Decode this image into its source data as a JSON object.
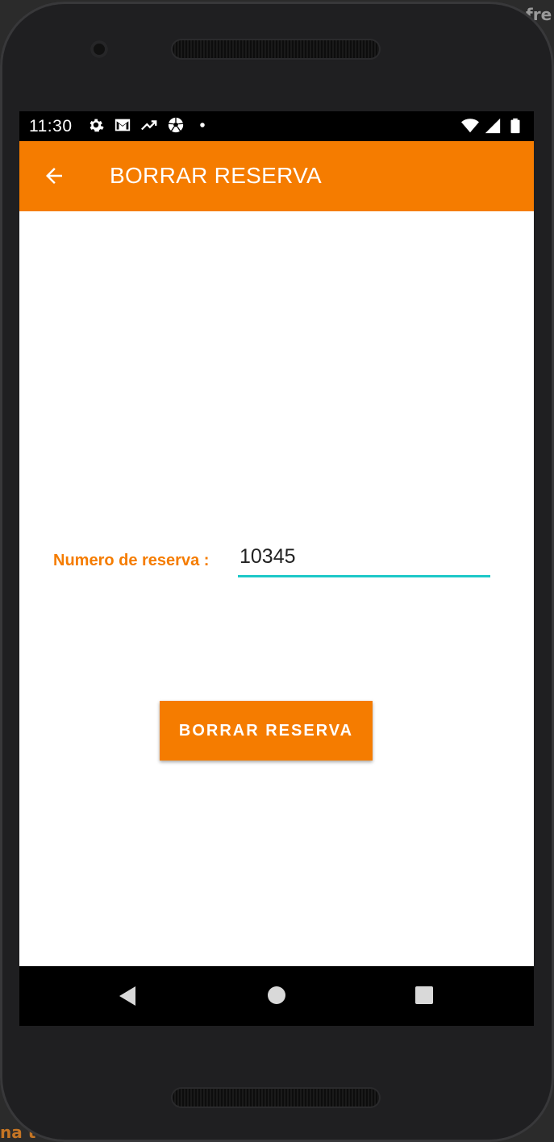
{
  "status_bar": {
    "time": "11:30",
    "left_icons": [
      "gear-icon",
      "gmail-icon",
      "trending-up-icon",
      "soccer-ball-icon",
      "dot-icon"
    ],
    "right_icons": [
      "wifi-icon",
      "signal-icon",
      "battery-icon"
    ]
  },
  "app_bar": {
    "title": "BORRAR RESERVA",
    "back_icon": "arrow-left-icon",
    "color": "#f57c00"
  },
  "form": {
    "label": "Numero de reserva :",
    "value": "10345",
    "underline_color": "#1dc8c8"
  },
  "action_button": {
    "label": "BORRAR RESERVA",
    "color": "#f57c00"
  },
  "nav_bar": {
    "icons": [
      "back-triangle-icon",
      "home-circle-icon",
      "recents-square-icon"
    ]
  },
  "background_text": {
    "top_right": "fre",
    "bottom_left": "na t"
  }
}
